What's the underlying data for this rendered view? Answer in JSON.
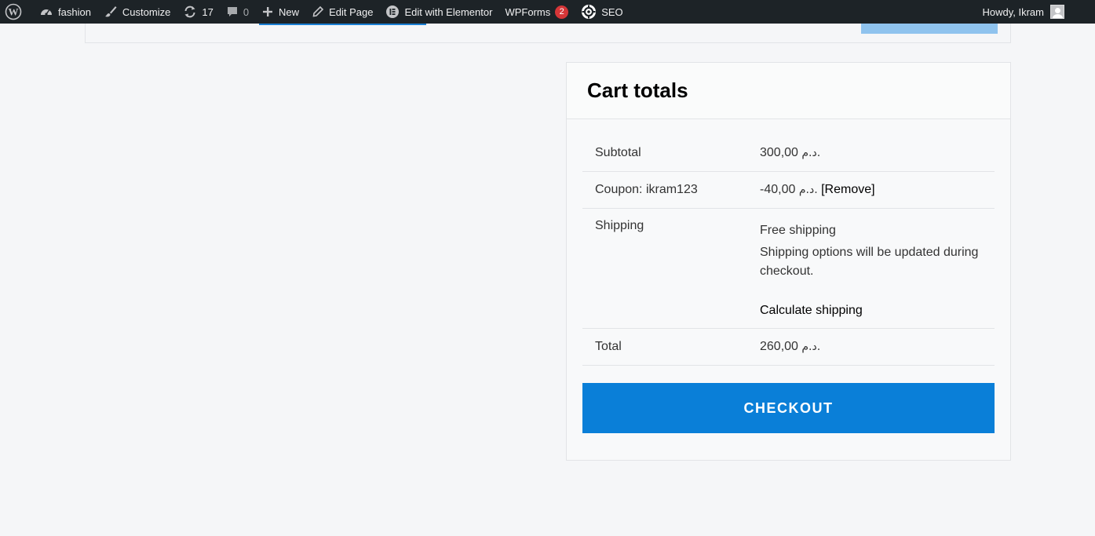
{
  "adminbar": {
    "site_name": "fashion",
    "customize": "Customize",
    "updates_count": "17",
    "comments_count": "0",
    "new_label": "New",
    "edit_page": "Edit Page",
    "edit_elementor": "Edit with Elementor",
    "wpforms": "WPForms",
    "wpforms_badge": "2",
    "seo": "SEO",
    "howdy": "Howdy, Ikram",
    "icons": [
      "wordpress-logo-icon",
      "dashboard-icon",
      "brush-icon",
      "refresh-icon",
      "comment-icon",
      "plus-icon",
      "pencil-icon",
      "elementor-icon",
      "seo-gear-icon",
      "avatar"
    ]
  },
  "cart_totals": {
    "title": "Cart totals",
    "subtotal_label": "Subtotal",
    "subtotal_value": "300,00",
    "coupon_label": "Coupon: ikram123",
    "coupon_value": "-40,00",
    "coupon_remove": "[Remove]",
    "shipping_label": "Shipping",
    "shipping_method": "Free shipping",
    "shipping_note": "Shipping options will be updated during checkout.",
    "calculate_shipping": "Calculate shipping",
    "total_label": "Total",
    "total_value": "260,00",
    "currency": "د.م.",
    "checkout_button": "CHECKOUT"
  },
  "colors": {
    "adminbar_bg": "#1d2327",
    "accent": "#0a7fd8",
    "badge": "#d63638"
  }
}
